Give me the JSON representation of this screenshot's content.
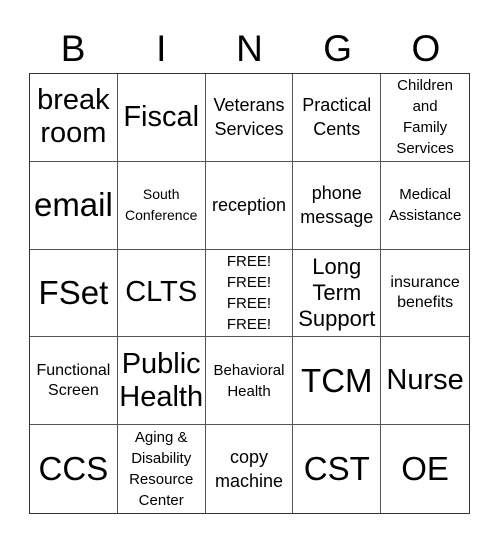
{
  "header": {
    "letters": [
      "B",
      "I",
      "N",
      "G",
      "O"
    ]
  },
  "card": {
    "cells": [
      {
        "text": "break\nroom",
        "size": "s-l"
      },
      {
        "text": "Fiscal",
        "size": "s-l"
      },
      {
        "text": "Veterans\nServices",
        "size": "s-mm"
      },
      {
        "text": "Practical\nCents",
        "size": "s-mm"
      },
      {
        "text": "Children\nand\nFamily\nServices",
        "size": "s-xs"
      },
      {
        "text": "email",
        "size": "s-xl"
      },
      {
        "text": "South\nConference",
        "size": "s-xxs"
      },
      {
        "text": "reception",
        "size": "s-mm"
      },
      {
        "text": "phone\nmessage",
        "size": "s-mm"
      },
      {
        "text": "Medical\nAssistance",
        "size": "s-xs"
      },
      {
        "text": "FSet",
        "size": "s-xl"
      },
      {
        "text": "CLTS",
        "size": "s-l"
      },
      {
        "text": "FREE!\nFREE!\nFREE!\nFREE!",
        "size": "s-xs"
      },
      {
        "text": "Long\nTerm\nSupport",
        "size": "s-m"
      },
      {
        "text": "insurance\nbenefits",
        "size": "s-s"
      },
      {
        "text": "Functional\nScreen",
        "size": "s-s"
      },
      {
        "text": "Public\nHealth",
        "size": "s-l"
      },
      {
        "text": "Behavioral\nHealth",
        "size": "s-xs"
      },
      {
        "text": "TCM",
        "size": "s-xl"
      },
      {
        "text": "Nurse",
        "size": "s-l"
      },
      {
        "text": "CCS",
        "size": "s-xl"
      },
      {
        "text": "Aging &\nDisability\nResource\nCenter",
        "size": "s-xs"
      },
      {
        "text": "copy\nmachine",
        "size": "s-mm"
      },
      {
        "text": "CST",
        "size": "s-xl"
      },
      {
        "text": "OE",
        "size": "s-xl"
      }
    ]
  }
}
